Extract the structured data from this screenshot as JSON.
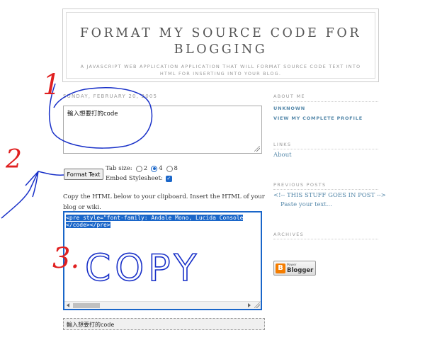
{
  "header": {
    "title": "FORMAT MY SOURCE CODE FOR BLOGGING",
    "description": "A JAVASCRIPT WEB APPLICATION APPLICATION THAT WILL FORMAT SOURCE CODE TEXT INTO HTML FOR INSERTING INTO YOUR BLOG."
  },
  "post": {
    "date": "SUNDAY, FEBRUARY 20, 2005",
    "input_value": "輸入想要打的code",
    "format_button": "Format Text",
    "tab_size_label": "Tab size:",
    "tab_options": [
      "2",
      "4",
      "8"
    ],
    "tab_selected": "4",
    "embed_label": "Embed Stylesheet:",
    "embed_checked": true,
    "copy_instructions": "Copy the HTML below to your clipboard. Insert the HTML of your blog or wiki.",
    "output_line1": "<pre style=\"font-family: Andale Mono, Lucida Console",
    "output_line2": "</code></pre>",
    "preview_text": "輸入想要打的code"
  },
  "sidebar": {
    "about_heading": "ABOUT ME",
    "about_name": "UNKNOWN",
    "profile_link": "VIEW MY COMPLETE PROFILE",
    "links_heading": "LINKS",
    "links_item": "About",
    "previous_heading": "PREVIOUS POSTS",
    "previous_item1": "<!-- THIS STUFF GOES IN POST -->",
    "previous_item2": "Paste your text...",
    "archives_heading": "ARCHIVES",
    "badge_small": "Power",
    "badge_big": "Blogger"
  },
  "annotations": {
    "mark1": "1",
    "mark2": "2",
    "mark3": "3.",
    "copy_word": "COPY"
  },
  "colors": {
    "accent": "#1a66c9",
    "annotation_blue": "#1830c8",
    "annotation_red": "#e02020",
    "link": "#5588aa"
  }
}
